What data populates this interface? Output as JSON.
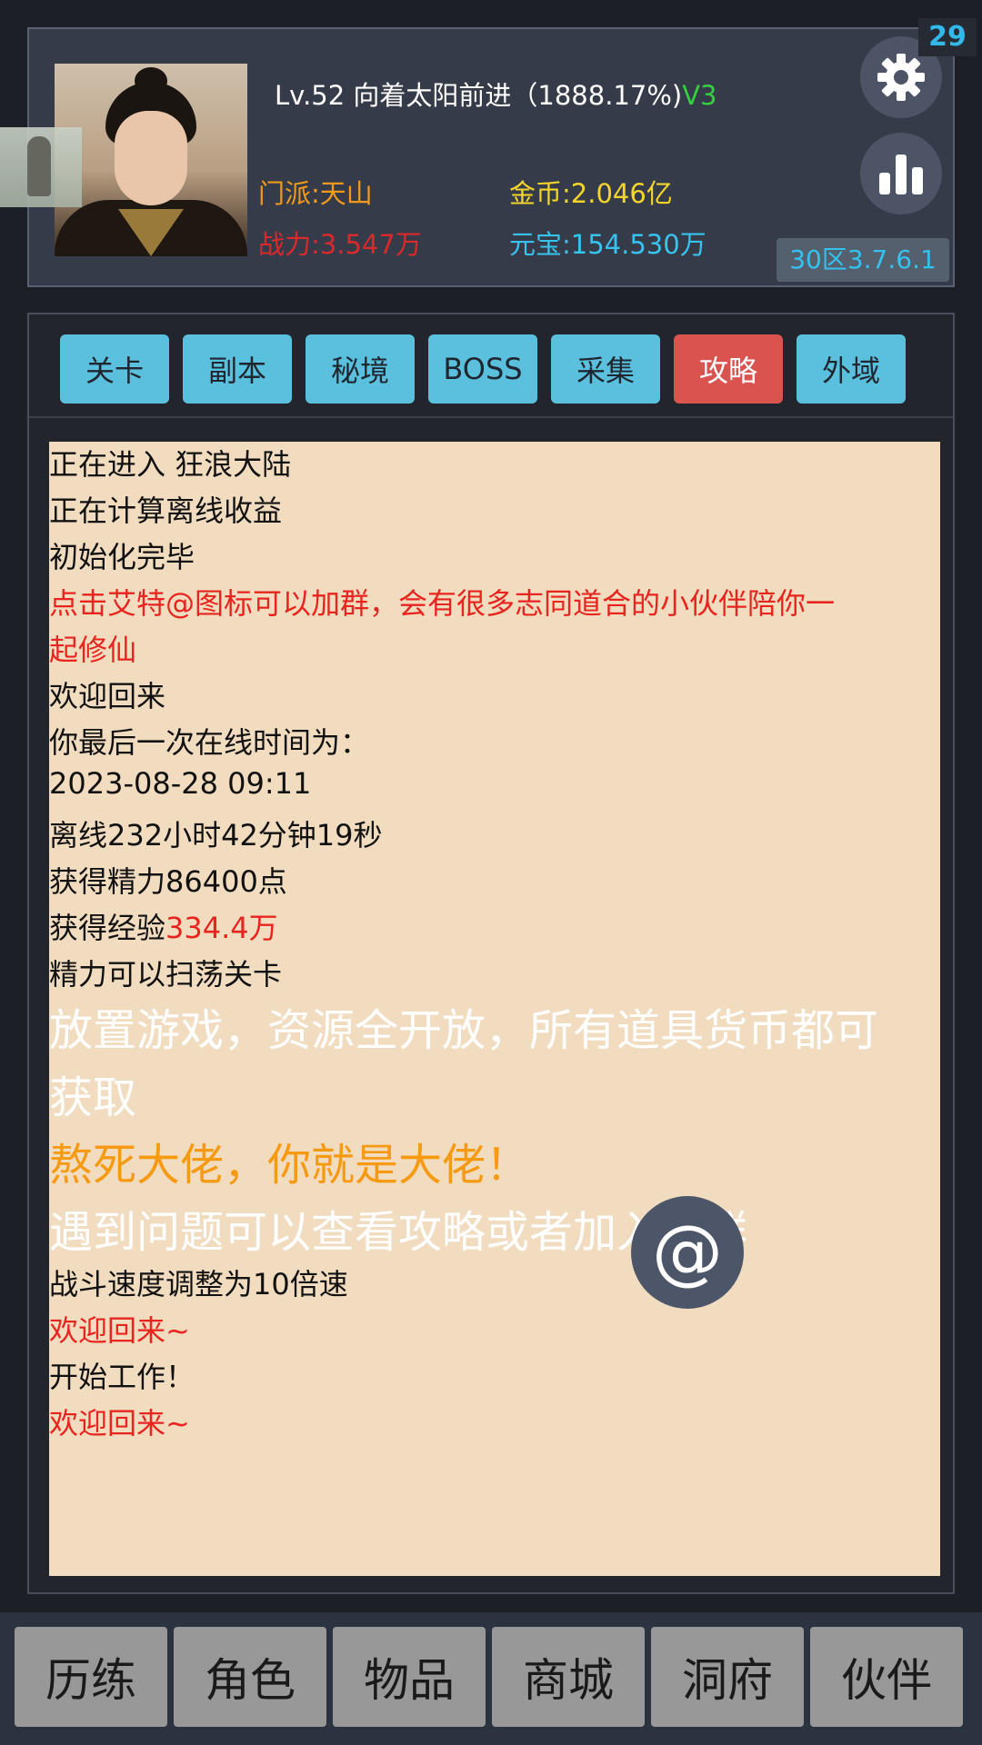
{
  "player": {
    "level_text": "Lv.52 向着太阳前进（1888.17%)",
    "vip": "V3",
    "sect": "门派:天山",
    "power": "战力:3.547万",
    "gold": "金币:2.046亿",
    "ingot": "元宝:154.530万",
    "notification_count": "29",
    "server": "30区3.7.6.1"
  },
  "tabs": [
    "关卡",
    "副本",
    "秘境",
    "BOSS",
    "采集",
    "攻略",
    "外域"
  ],
  "active_tab": "攻略",
  "log": {
    "lines": [
      "正在进入 狂浪大陆",
      "正在计算离线收益",
      "初始化完毕",
      "点击艾特@图标可以加群，会有很多志同道合的小伙伴陪你一",
      "起修仙",
      "欢迎回来",
      "你最后一次在线时间为：",
      "2023-08-28 09:11",
      "离线232小时42分钟19秒",
      "获得精力86400点",
      "获得经验",
      "334.4万",
      "精力可以扫荡关卡",
      "放置游戏，资源全开放，所有道具货币都可",
      "获取",
      "熬死大佬，你就是大佬！",
      "遇到问题可以查看攻略或者加入加群",
      "战斗速度调整为10倍速",
      "欢迎回来~",
      "开始工作！",
      "欢迎回来~"
    ]
  },
  "at_button": "@",
  "nav": [
    "历练",
    "角色",
    "物品",
    "商城",
    "洞府",
    "伙伴"
  ],
  "colors": {
    "tab": "#5bc0de",
    "tab_active": "#d9534f",
    "log_bg": "#f2dcc0",
    "highlight_red": "#e8241e",
    "orange": "#f59a12"
  }
}
